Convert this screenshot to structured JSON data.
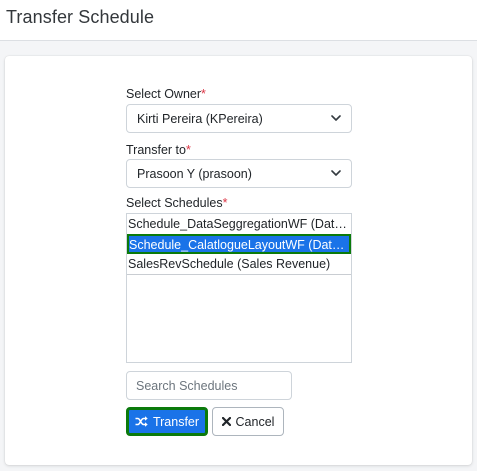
{
  "page": {
    "title": "Transfer Schedule"
  },
  "form": {
    "owner": {
      "label": "Select Owner",
      "required_mark": "*",
      "value": "Kirti Pereira (KPereira)"
    },
    "transfer_to": {
      "label": "Transfer to",
      "required_mark": "*",
      "value": "Prasoon Y (prasoon)"
    },
    "schedules": {
      "label": "Select Schedules",
      "required_mark": "*",
      "options": [
        "Schedule_DataSeggregationWF (DataSeggregation)",
        "Schedule_CalatlogueLayoutWF (DataSeggregation)",
        "SalesRevSchedule (Sales Revenue)"
      ],
      "selected_index": 1
    },
    "search": {
      "placeholder": "Search Schedules",
      "value": ""
    },
    "transfer_button": {
      "label": "Transfer",
      "icon": "shuffle-icon"
    },
    "cancel_button": {
      "label": "Cancel",
      "icon": "close-icon"
    }
  },
  "colors": {
    "primary": "#1a73e8",
    "focus_outline": "#0b7a0b",
    "required": "#dc3545"
  }
}
